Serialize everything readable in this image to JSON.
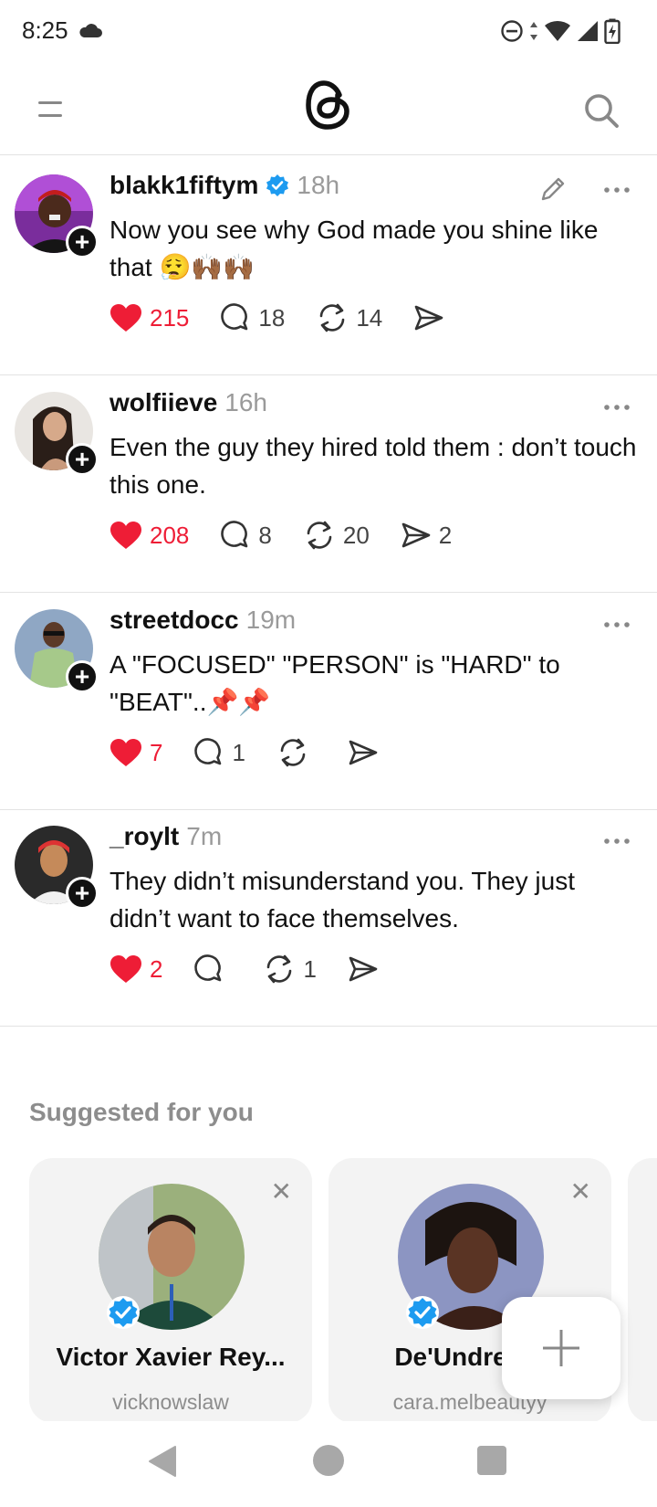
{
  "status_bar": {
    "time": "8:25"
  },
  "app": {
    "colors": {
      "like": "#ee1d36",
      "verified": "#1d9bf0"
    }
  },
  "posts": [
    {
      "username": "blakk1fiftym",
      "verified": true,
      "time": "18h",
      "text": "Now you see why God made you shine like that 😮‍💨🙌🏾🙌🏾",
      "likes": "215",
      "replies": "18",
      "reposts": "14",
      "shares": ""
    },
    {
      "username": "wolfiieve",
      "verified": false,
      "time": "16h",
      "text": "Even the guy they hired told them : don’t touch this one.",
      "likes": "208",
      "replies": "8",
      "reposts": "20",
      "shares": "2"
    },
    {
      "username": "streetdocc",
      "verified": false,
      "time": "19m",
      "text": "A \"FOCUSED\" \"PERSON\" is \"HARD\" to \"BEAT\"..📌📌",
      "likes": "7",
      "replies": "1",
      "reposts": "",
      "shares": ""
    },
    {
      "username": "_roylt",
      "verified": false,
      "time": "7m",
      "text": "They didn’t misunderstand you. They just didn’t want to face themselves.",
      "likes": "2",
      "replies": "",
      "reposts": "1",
      "shares": ""
    }
  ],
  "suggested": {
    "title": "Suggested for you",
    "cards": [
      {
        "name": "Victor Xavier Rey...",
        "handle": "vicknowslaw",
        "verified": true
      },
      {
        "name": "De'Undrea S",
        "handle": "cara.melbeautyy",
        "verified": true
      }
    ]
  }
}
